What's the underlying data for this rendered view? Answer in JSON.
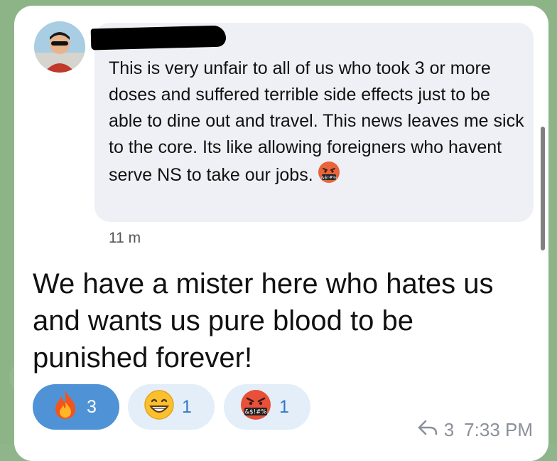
{
  "quote": {
    "text": "This is very unfair to all of us who took 3 or more doses and suffered terrible side effects just to be able to dine out and travel. This news leaves me sick to the core. Its like allowing foreigners who havent serve NS to take our jobs.",
    "emoji": "angry-cursing-face",
    "time": "11 m"
  },
  "message": {
    "text": "We have a mister here who hates us and wants us pure blood to be punished forever!"
  },
  "reactions": [
    {
      "emoji": "fire",
      "count": "3",
      "selected": true
    },
    {
      "emoji": "grinning-face",
      "count": "1",
      "selected": false
    },
    {
      "emoji": "angry-cursing-face",
      "count": "1",
      "selected": false
    }
  ],
  "footer": {
    "forward_count": "3",
    "time": "7:33 PM"
  },
  "colors": {
    "background": "#8db487",
    "bubble": "#eef0f6",
    "selected_reaction": "#4f93d6",
    "unselected_reaction": "#e3eef9",
    "meta_text": "#8a8f99"
  }
}
